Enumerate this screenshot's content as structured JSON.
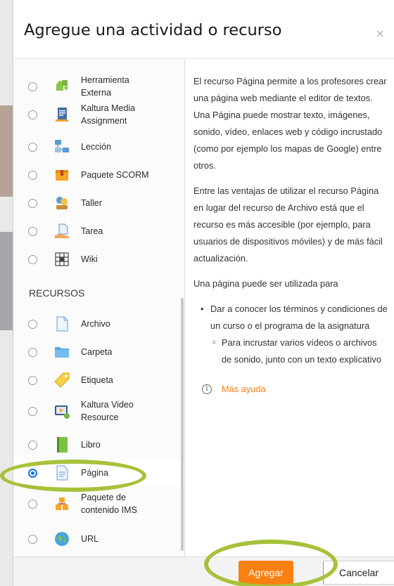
{
  "modal": {
    "title": "Agregue una actividad o recurso",
    "close_glyph": "×"
  },
  "left": {
    "activities": [
      {
        "label": "Herramienta\nExterna",
        "icon": "puzzle-icon"
      },
      {
        "label": "Kaltura Media\nAssignment",
        "icon": "kaltura-assignment-icon"
      },
      {
        "label": "Lección",
        "icon": "lesson-icon"
      },
      {
        "label": "Paquete SCORM",
        "icon": "scorm-icon"
      },
      {
        "label": "Taller",
        "icon": "workshop-icon"
      },
      {
        "label": "Tarea",
        "icon": "assignment-icon"
      },
      {
        "label": "Wiki",
        "icon": "wiki-icon"
      }
    ],
    "section_title": "RECURSOS",
    "resources": [
      {
        "label": "Archivo",
        "icon": "file-icon"
      },
      {
        "label": "Carpeta",
        "icon": "folder-icon"
      },
      {
        "label": "Etiqueta",
        "icon": "label-icon"
      },
      {
        "label": "Kaltura Video\nResource",
        "icon": "kaltura-video-icon"
      },
      {
        "label": "Libro",
        "icon": "book-icon"
      },
      {
        "label": "Página",
        "icon": "page-icon",
        "selected": true
      },
      {
        "label": "Paquete de\ncontenido IMS",
        "icon": "ims-icon"
      },
      {
        "label": "URL",
        "icon": "url-icon"
      }
    ]
  },
  "description": {
    "p1": "El recurso Página permite a los profesores crear una página web mediante el editor de textos. Una Página puede mostrar texto, imágenes, sonido, vídeo, enlaces web y código incrustado (como por ejemplo los mapas de Google) entre otros.",
    "p2": "Entre las ventajas de utilizar el recurso Página en lugar del recurso de Archivo está que el recurso es más accesible (por ejemplo, para usuarios de dispositivos móviles) y de más fácil actualización.",
    "p3": "Una página puede ser utilizada para",
    "bullet1": "Dar a conocer los términos y condiciones de un curso o el programa de la asignatura",
    "sub1": "Para incrustar varios vídeos o archivos de sonido, junto con un texto explicativo",
    "more_help": "Más ayuda",
    "info_glyph": "i"
  },
  "footer": {
    "add_label": "Agregar",
    "cancel_label": "Cancelar"
  },
  "colors": {
    "accent": "#f98012",
    "highlight": "#a6c23a",
    "radio_selected": "#1a73e8"
  }
}
